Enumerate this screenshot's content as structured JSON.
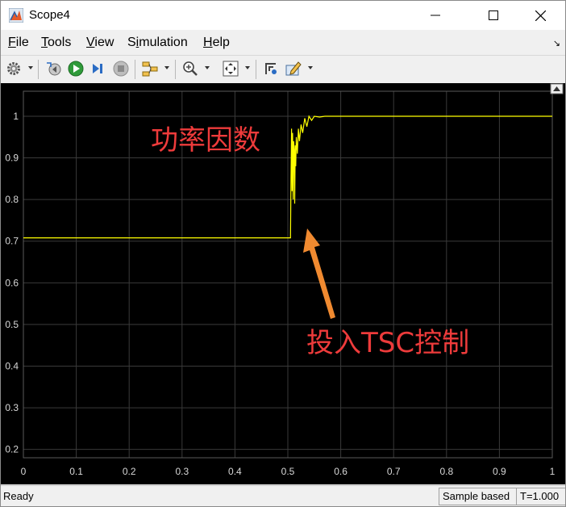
{
  "window": {
    "title": "Scope4"
  },
  "menu": {
    "items": [
      {
        "label": "File",
        "mnemonic": "F",
        "rest": "ile"
      },
      {
        "label": "Tools",
        "mnemonic": "T",
        "rest": "ools"
      },
      {
        "label": "View",
        "mnemonic": "V",
        "rest": "iew"
      },
      {
        "label": "Simulation",
        "mnemonic": "i",
        "prefix": "S",
        "rest": "mulation"
      },
      {
        "label": "Help",
        "mnemonic": "H",
        "rest": "elp"
      }
    ]
  },
  "toolbar": {
    "icons": [
      "gear-icon",
      "step-back-icon",
      "run-icon",
      "step-forward-icon",
      "stop-icon",
      "signal-selector-icon",
      "zoom-in-icon",
      "fit-view-icon",
      "cursor-measure-icon",
      "edit-settings-icon"
    ]
  },
  "colors": {
    "signal": "#ffff00",
    "annotation": "#ee3b3b",
    "arrow": "#f08a30",
    "plot_bg": "#000000",
    "grid": "#3a3a3a"
  },
  "annotations": {
    "power_factor": "功率因数",
    "tsc_control": "投入TSC控制"
  },
  "status": {
    "ready": "Ready",
    "sample_mode": "Sample based",
    "time": "T=1.000"
  },
  "chart_data": {
    "type": "line",
    "title": "",
    "xlabel": "",
    "ylabel": "",
    "xlim": [
      0,
      1
    ],
    "ylim": [
      0.18,
      1.06
    ],
    "xticks": [
      "0",
      "0.1",
      "0.2",
      "0.3",
      "0.4",
      "0.5",
      "0.6",
      "0.7",
      "0.8",
      "0.9",
      "1"
    ],
    "yticks": [
      "0.2",
      "0.3",
      "0.4",
      "0.5",
      "0.6",
      "0.7",
      "0.8",
      "0.9",
      "1"
    ],
    "grid": true,
    "series": [
      {
        "color": "#ffff00",
        "x": [
          0,
          0.505,
          0.506,
          0.507,
          0.508,
          0.509,
          0.51,
          0.511,
          0.512,
          0.513,
          0.514,
          0.515,
          0.516,
          0.518,
          0.52,
          0.522,
          0.525,
          0.528,
          0.532,
          0.536,
          0.54,
          0.545,
          0.55,
          0.56,
          0.57,
          1.0
        ],
        "y": [
          0.708,
          0.708,
          0.85,
          0.97,
          0.82,
          0.96,
          0.8,
          0.94,
          0.92,
          0.79,
          0.93,
          0.88,
          0.95,
          0.91,
          0.97,
          0.94,
          0.98,
          0.96,
          0.995,
          0.975,
          1.0,
          0.99,
          1.0,
          0.998,
          1.0,
          1.0
        ]
      }
    ]
  }
}
